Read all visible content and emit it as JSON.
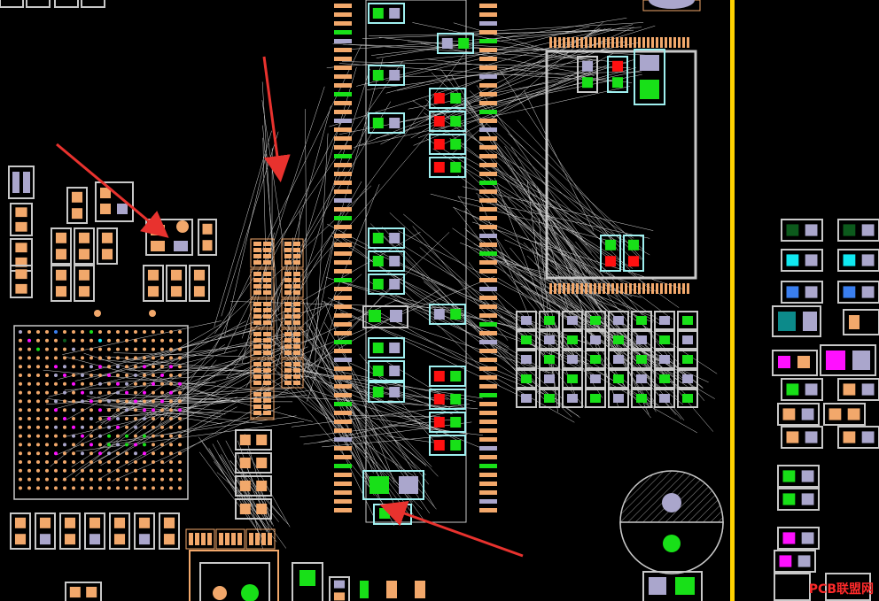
{
  "view": {
    "name": "pcb-layout-canvas"
  },
  "colors": {
    "background": "#000000",
    "pad": "#f2a86b",
    "outline": "#c8c8c8",
    "outline_cyan": "#9fefef",
    "ratsnest": "#d2d2d2",
    "board_edge": "#ffd200",
    "pad_green": "#18e018",
    "pad_red": "#ff1010",
    "pad_lavender": "#aaa6cc",
    "pad_magenta": "#ff10ff",
    "pad_blue": "#3a7ff0",
    "pad_cyan": "#10e8f0",
    "pad_teal": "#0c8a8a",
    "pad_darkgreen": "#0c5a1c",
    "arrow": "#e8322e",
    "watermark": "#ff2a2a"
  },
  "annotations": {
    "arrows": [
      {
        "name": "annotation-arrow-left",
        "target": "component-cluster"
      },
      {
        "name": "annotation-arrow-top",
        "target": "resistor-array"
      },
      {
        "name": "annotation-arrow-bottom",
        "target": "capacitor-pair"
      }
    ]
  },
  "watermark": {
    "text": "PCB联盟网",
    "logo": true
  }
}
